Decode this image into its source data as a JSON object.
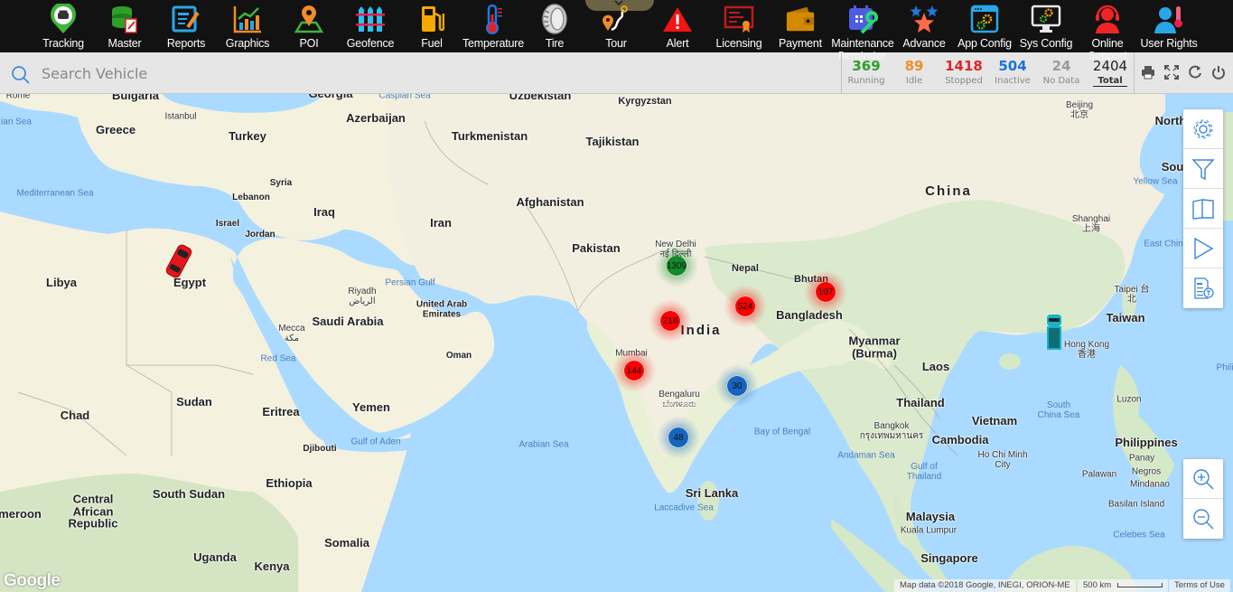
{
  "nav": {
    "items": [
      {
        "label": "Tracking",
        "icon": "tracking-pin-icon"
      },
      {
        "label": "Master",
        "icon": "database-edit-icon"
      },
      {
        "label": "Reports",
        "icon": "report-edit-icon"
      },
      {
        "label": "Graphics",
        "icon": "bar-chart-icon"
      },
      {
        "label": "POI",
        "icon": "map-pin-icon"
      },
      {
        "label": "Geofence",
        "icon": "fence-icon"
      },
      {
        "label": "Fuel",
        "icon": "fuel-pump-icon"
      },
      {
        "label": "Temperature",
        "icon": "thermometer-icon"
      },
      {
        "label": "Tire",
        "icon": "tire-icon"
      },
      {
        "label": "Tour",
        "icon": "route-icon"
      },
      {
        "label": "Alert",
        "icon": "alert-triangle-icon"
      },
      {
        "label": "Licensing",
        "icon": "certificate-icon"
      },
      {
        "label": "Payment",
        "icon": "wallet-icon"
      },
      {
        "label": "Maintenance",
        "icon": "calendar-wrench-icon"
      },
      {
        "label": "Advance",
        "icon": "stars-icon"
      },
      {
        "label": "App Config",
        "icon": "app-gears-icon"
      },
      {
        "label": "Sys Config",
        "icon": "monitor-gears-icon"
      },
      {
        "label": "Online",
        "icon": "headset-support-icon"
      },
      {
        "label": "User Rights",
        "icon": "user-thermometer-icon"
      }
    ],
    "ghost_labels": {
      "reminder": "Reminder",
      "support": "Support"
    }
  },
  "search": {
    "placeholder": "Search Vehicle",
    "value": ""
  },
  "status_counts": [
    {
      "key": "running",
      "value": "369",
      "label": "Running",
      "color": "#2ca02c"
    },
    {
      "key": "idle",
      "value": "89",
      "label": "Idle",
      "color": "#f28c28"
    },
    {
      "key": "stopped",
      "value": "1418",
      "label": "Stopped",
      "color": "#e0242a"
    },
    {
      "key": "inactive",
      "value": "504",
      "label": "Inactive",
      "color": "#1a73d9"
    },
    {
      "key": "nodata",
      "value": "24",
      "label": "No Data",
      "color": "#9a9a9a"
    },
    {
      "key": "total",
      "value": "2404",
      "label": "Total",
      "color": "#222222"
    }
  ],
  "toolbar": {
    "print": "print-icon",
    "fullscreen": "fullscreen-icon",
    "refresh": "refresh-icon",
    "logout": "power-icon"
  },
  "map": {
    "clusters": [
      {
        "count": "1309",
        "status": "running",
        "color": "#128a2c",
        "near": "New Delhi"
      },
      {
        "count": "216",
        "status": "stopped",
        "color": "#ff0000",
        "near": "Central India"
      },
      {
        "count": "524",
        "status": "stopped",
        "color": "#ff0000",
        "near": "East India"
      },
      {
        "count": "107",
        "status": "stopped",
        "color": "#ff0000",
        "near": "Bhutan"
      },
      {
        "count": "144",
        "status": "stopped",
        "color": "#ff0000",
        "near": "Mumbai"
      },
      {
        "count": "30",
        "status": "inactive",
        "color": "#1565c0",
        "near": "Andhra coast"
      },
      {
        "count": "48",
        "status": "inactive",
        "color": "#1565c0",
        "near": "Bengaluru"
      }
    ],
    "vehicles": [
      {
        "near": "Egypt",
        "color": "#e3161b",
        "status": "stopped"
      },
      {
        "near": "Hong Kong",
        "color": "#19b2c9",
        "status": "inactive"
      }
    ],
    "countries": [
      "Bulgaria",
      "Georgia",
      "Greece",
      "Turkey",
      "Azerbaijan",
      "Uzbekistan",
      "Kyrgyzstan",
      "Turkmenistan",
      "Tajikistan",
      "Syria",
      "Lebanon",
      "Iraq",
      "Iran",
      "Afghanistan",
      "Israel",
      "Jordan",
      "Libya",
      "Egypt",
      "Pakistan",
      "Nepal",
      "Bhutan",
      "Saudi Arabia",
      "United Arab Emirates",
      "Oman",
      "India",
      "Bangladesh",
      "Myanmar (Burma)",
      "Laos",
      "Thailand",
      "Vietnam",
      "Cambodia",
      "Sudan",
      "Chad",
      "Eritrea",
      "Yemen",
      "Djibouti",
      "Ethiopia",
      "South Sudan",
      "Central African Republic",
      "Cameroon",
      "Somalia",
      "Uganda",
      "Kenya",
      "Sri Lanka",
      "Malaysia",
      "Singapore",
      "China",
      "Taiwan",
      "Philippines",
      "North Korea",
      "South Korea"
    ],
    "country_labels": {
      "china": "China",
      "india": "India"
    },
    "cities": [
      "Rome",
      "Istanbul",
      "New Delhi",
      "Riyadh",
      "Mecca",
      "Mumbai",
      "Bengaluru",
      "Bangkok",
      "Ho Chi Minh City",
      "Kuala Lumpur",
      "Hong Kong",
      "Taipei",
      "Beijing",
      "Shanghai",
      "Luzon",
      "Panay",
      "Negros",
      "Mindanao",
      "Palawan",
      "Basilan Island"
    ],
    "seas": [
      "Mediterranean Sea",
      "Caspian Sea",
      "Persian Gulf",
      "Red Sea",
      "Gulf of Aden",
      "Arabian Sea",
      "Laccadive Sea",
      "Bay of Bengal",
      "Andaman Sea",
      "Gulf of Thailand",
      "South China Sea",
      "Celebes Sea",
      "Yellow Sea",
      "East China Sea",
      "Philippine Sea",
      "Ionian Sea"
    ],
    "side_controls": [
      "settings-gear-icon",
      "filter-funnel-icon",
      "map-book-icon",
      "play-icon",
      "text-report-icon"
    ],
    "zoom_controls": [
      "zoom-in-icon",
      "zoom-out-icon"
    ],
    "attribution": "Map data ©2018 Google, INEGI, ORION-ME",
    "scale": "500 km",
    "terms": "Terms of Use",
    "logo": "Google"
  },
  "labels": {
    "Bulgaria": "Bulgaria",
    "Georgia": "Georgia",
    "Greece": "Greece",
    "Turkey": "Turkey",
    "Azerbaijan": "Azerbaijan",
    "Uzbekistan": "Uzbekistan",
    "Kyrgyzstan": "Kyrgyzstan",
    "Turkmenistan": "Turkmenistan",
    "Tajikistan": "Tajikistan",
    "Syria": "Syria",
    "Lebanon": "Lebanon",
    "Iraq": "Iraq",
    "Iran": "Iran",
    "Afghanistan": "Afghanistan",
    "Israel": "Israel",
    "Jordan": "Jordan",
    "Libya": "Libya",
    "Egypt": "Egypt",
    "Pakistan": "Pakistan",
    "Nepal": "Nepal",
    "Bhutan": "Bhutan",
    "SaudiArabia": "Saudi Arabia",
    "UAE": "United Arab Emirates",
    "Oman": "Oman",
    "India": "India",
    "Bangladesh": "Bangladesh",
    "Myanmar": "Myanmar (Burma)",
    "Laos": "Laos",
    "Thailand": "Thailand",
    "Vietnam": "Vietnam",
    "Cambodia": "Cambodia",
    "Sudan": "Sudan",
    "Chad": "Chad",
    "Eritrea": "Eritrea",
    "Yemen": "Yemen",
    "Djibouti": "Djibouti",
    "Ethiopia": "Ethiopia",
    "SouthSudan": "South Sudan",
    "CAR": "Central African Republic",
    "Cameroon": "meroon",
    "Somalia": "Somalia",
    "Uganda": "Uganda",
    "Kenya": "Kenya",
    "SriLanka": "Sri Lanka",
    "Malaysia": "Malaysia",
    "Singapore": "Singapore",
    "China": "China",
    "Taiwan": "Taiwan",
    "Philippines": "Philippines",
    "NorthKorea": "North",
    "SouthKorea": "Sou",
    "Rome": "Rome",
    "Istanbul": "Istanbul",
    "NewDelhi": "New Delhi नई दिल्ली",
    "Riyadh": "Riyadh الرياض",
    "Mecca": "Mecca مكة",
    "Mumbai": "Mumbai",
    "Bengaluru": "Bengaluru ಬೆಂಗಳೂರು",
    "Bangkok": "Bangkok กรุงเทพมหานคร",
    "HCMC": "Ho Chi Minh City",
    "KualaLumpur": "Kuala Lumpur",
    "HongKong": "Hong Kong 香港",
    "Taipei": "Taipei 台北",
    "Beijing": "Beijing 北京",
    "Shanghai": "Shanghai 上海",
    "Luzon": "Luzon",
    "Panay": "Panay",
    "Negros": "Negros",
    "Mindanao": "Mindanao",
    "Palawan": "Palawan",
    "Basilan": "Basilan Island",
    "Med": "Mediterranean Sea",
    "Caspian": "Caspian Sea",
    "Persian": "Persian Gulf",
    "Red": "Red Sea",
    "Aden": "Gulf of Aden",
    "Arabian": "Arabian Sea",
    "Laccadive": "Laccadive Sea",
    "Bengal": "Bay of Bengal",
    "Andaman": "Andaman Sea",
    "GulfThai": "Gulf of Thailand",
    "SCS": "South China Sea",
    "Celebes": "Celebes Sea",
    "Yellow": "Yellow Sea",
    "ECS": "East Chin",
    "PhilSea": "Phili",
    "Ionian": "ian Sea"
  }
}
